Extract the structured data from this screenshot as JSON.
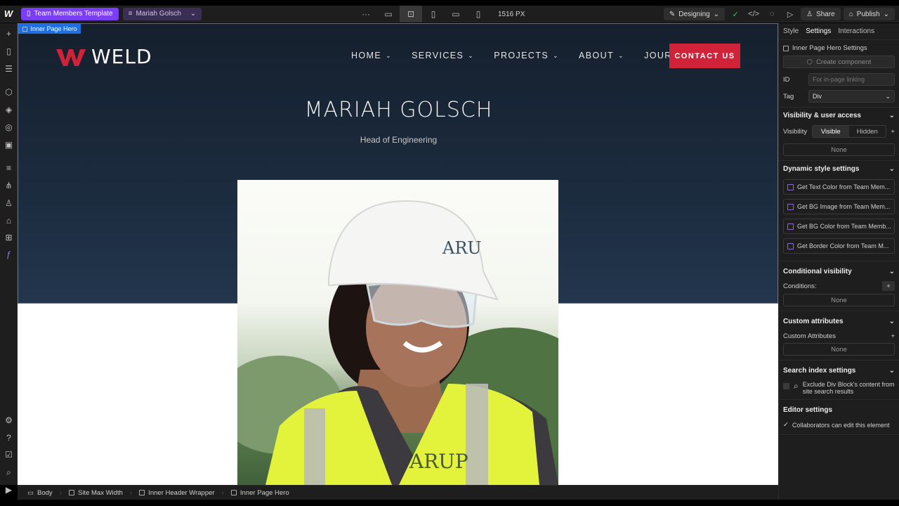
{
  "topbar": {
    "logo": "W",
    "page_pill": "Team Members Template",
    "item_pill": "Mariah Golsch",
    "width_label": "1516 PX",
    "mode": "Designing",
    "share": "Share",
    "publish": "Publish"
  },
  "canvas": {
    "selected_tag": "Inner Page Hero",
    "logo_text": "WELD",
    "nav": [
      "HOME",
      "SERVICES",
      "PROJECTS",
      "ABOUT",
      "JOURNAL"
    ],
    "contact": "CONTACT US",
    "title": "MARIAH GOLSCH",
    "subtitle": "Head of Engineering",
    "helmet_text": "ARU",
    "vest_text": "ARUP"
  },
  "breadcrumb": [
    "Body",
    "Site Max Width",
    "Inner Header Wrapper",
    "Inner Page Hero"
  ],
  "panel": {
    "tabs": [
      "Style",
      "Settings",
      "Interactions"
    ],
    "settings_header": "Inner Page Hero Settings",
    "create_component": "Create component",
    "id_label": "ID",
    "id_placeholder": "For in-page linking",
    "tag_label": "Tag",
    "tag_value": "Div",
    "visibility_section": "Visibility & user access",
    "visibility_label": "Visibility",
    "visible": "Visible",
    "hidden": "Hidden",
    "none": "None",
    "dynamic_section": "Dynamic style settings",
    "dynamic_items": [
      "Get Text Color from  Team Mem...",
      "Get BG Image from  Team Mem...",
      "Get BG Color from  Team Memb...",
      "Get Border Color from  Team M..."
    ],
    "conditional_section": "Conditional visibility",
    "conditions_label": "Conditions:",
    "custom_section": "Custom attributes",
    "custom_label": "Custom Attributes",
    "search_section": "Search index settings",
    "search_text": "Exclude Div Block's content from site search results",
    "editor_section": "Editor settings",
    "editor_text": "Collaborators can edit this element"
  },
  "colors": {
    "accent": "#7a3ff2",
    "brand_red": "#d0233a",
    "selection": "#1f6fe0"
  }
}
